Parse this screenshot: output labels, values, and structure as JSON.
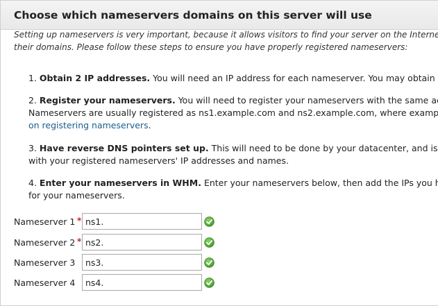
{
  "section": {
    "title": "Choose which nameservers domains on this server will use",
    "intro_line1": "Setting up nameservers is very important, because it allows visitors to find your server on the Internet. C",
    "intro_line2": "their domains. Please follow these steps to ensure you have properly registered nameservers:"
  },
  "steps": [
    {
      "num": "1.",
      "bold": "Obtain 2 IP addresses.",
      "text": " You will need an IP address for each nameserver. You may obtain t"
    },
    {
      "num": "2.",
      "bold": "Register your nameservers.",
      "text": " You will need to register your nameservers with the same acc",
      "line2": "Nameservers are usually registered as ns1.example.com and ns2.example.com, where examp",
      "link": "on registering nameservers",
      "link_after": "."
    },
    {
      "num": "3.",
      "bold": "Have reverse DNS pointers set up.",
      "text": " This will need to be done by your datacenter, and is in",
      "line2": "with your registered nameservers' IP addresses and names."
    },
    {
      "num": "4.",
      "bold": "Enter your nameservers in WHM.",
      "text": " Enter your nameservers below, then add the IPs you hav",
      "line2": "for your nameservers."
    }
  ],
  "nameservers": [
    {
      "label": "Nameserver 1",
      "required": "*",
      "value": "ns1."
    },
    {
      "label": "Nameserver 2",
      "required": "*",
      "value": "ns2."
    },
    {
      "label": "Nameserver 3",
      "required": "",
      "value": "ns3."
    },
    {
      "label": "Nameserver 4",
      "required": "",
      "value": "ns4."
    }
  ],
  "icons": {
    "valid": "check-circle-icon"
  },
  "colors": {
    "link": "#1b5d8c",
    "required": "#cc2222",
    "valid_green": "#4aa62e"
  }
}
